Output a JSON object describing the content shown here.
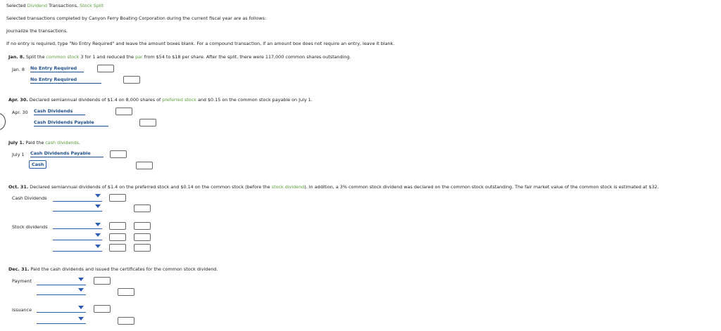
{
  "header": {
    "prefix": "Selected ",
    "link1": "Dividend",
    "mid": " Transactions, ",
    "link2": "Stock Split"
  },
  "intro": "Selected transactions completed by Canyon Ferry Boating Corporation during the current fiscal year are as follows:",
  "instruction1": "Journalize the transactions.",
  "instruction2": "If no entry is required, type \"No Entry Required\" and leave the amount boxes blank. For a compound transaction, if an amount box does not require an entry, leave it blank.",
  "jan": {
    "date_bold": "Jan. 8.",
    "desc_a": " Split the ",
    "desc_link": "common stock",
    "desc_b": " 3 for 1 and reduced the ",
    "desc_link2": "par",
    "desc_c": " from $54 to $18 per share. After the split, there were 117,000 common shares outstanding.",
    "entry_date": "Jan. 8",
    "line1": "No Entry Required",
    "line2": "No Entry Required"
  },
  "apr": {
    "date_bold": "Apr. 30.",
    "desc_a": " Declared semiannual dividends of $1.4 on 8,000 shares of ",
    "desc_link": "preferred stock",
    "desc_b": " and $0.15 on the common stock payable on July 1.",
    "entry_date": "Apr. 30",
    "line1": "Cash Dividends",
    "line2": "Cash Dividends Payable"
  },
  "jul": {
    "date_bold": "July 1.",
    "desc_a": " Paid the ",
    "desc_link": "cash dividends",
    "desc_b": ".",
    "entry_date": "July 1",
    "line1": "Cash Dividends Payable",
    "line2": "Cash"
  },
  "oct": {
    "date_bold": "Oct. 31.",
    "desc_a": " Declared semiannual dividends of $1.4 on the preferred stock and $0.14 on the common stock (before the ",
    "desc_link": "stock dividend",
    "desc_b": "). In addition, a 3% common stock dividend was declared on the common stock outstanding. The fair market value of the common stock is estimated at $32.",
    "label1": "Cash Dividends",
    "label2": "Stock dividends"
  },
  "dec": {
    "date_bold": "Dec. 31.",
    "desc": " Paid the cash dividends and issued the certificates for the common stock dividend.",
    "label1": "Payment",
    "label2": "Issuance"
  },
  "colors": {
    "link_green": "#5a9e3a",
    "account_blue": "#1f4e8c",
    "dropdown_blue": "#2a5db0"
  }
}
